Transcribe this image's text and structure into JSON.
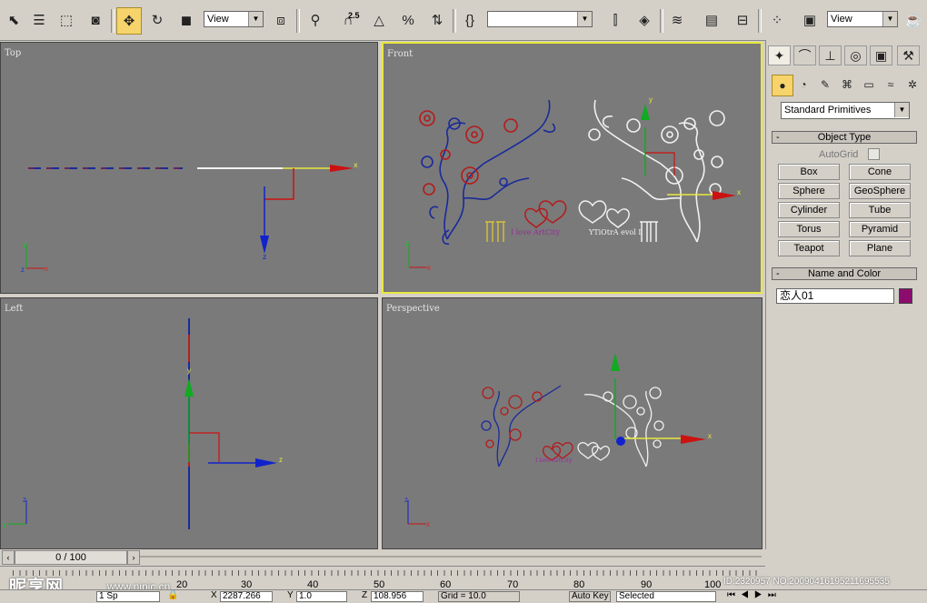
{
  "toolbar": {
    "view_dropdown_1": "View",
    "view_dropdown_2": "View",
    "snap_angle_label": "2.5",
    "named_selection": ""
  },
  "viewports": {
    "top": "Top",
    "front": "Front",
    "left": "Left",
    "perspective": "Perspective"
  },
  "front_text": {
    "red_text": "I love ArtCity",
    "white_text": "YTiOtrA evol I"
  },
  "command_panel": {
    "category_dropdown": "Standard Primitives",
    "object_type_title": "Object Type",
    "autogrid_label": "AutoGrid",
    "buttons": [
      "Box",
      "Cone",
      "Sphere",
      "GeoSphere",
      "Cylinder",
      "Tube",
      "Torus",
      "Pyramid",
      "Teapot",
      "Plane"
    ],
    "name_color_title": "Name and Color",
    "object_name": "恋人01",
    "object_color": "#8a0c6e"
  },
  "timeline": {
    "frame_counter": "0 / 100",
    "ticks": [
      "20",
      "30",
      "40",
      "50",
      "60",
      "70",
      "80",
      "90",
      "100"
    ]
  },
  "status_bar": {
    "selection": "1 Sp",
    "x_value": "2287.266",
    "y_value": "1.0",
    "z_value": "108.956",
    "grid": "Grid = 10.0",
    "auto_key": "Auto Key",
    "selected": "Selected"
  },
  "watermark": {
    "logo": "昵享网",
    "url": "www.nipic.cn",
    "id_text": "ID:2320957 NO:20090416195211695535"
  },
  "colors": {
    "viewport_bg": "#7a7a7a",
    "active_border": "#e8e840",
    "axis_x": "#cc1111",
    "axis_y": "#11aa22",
    "axis_z": "#1122cc"
  }
}
